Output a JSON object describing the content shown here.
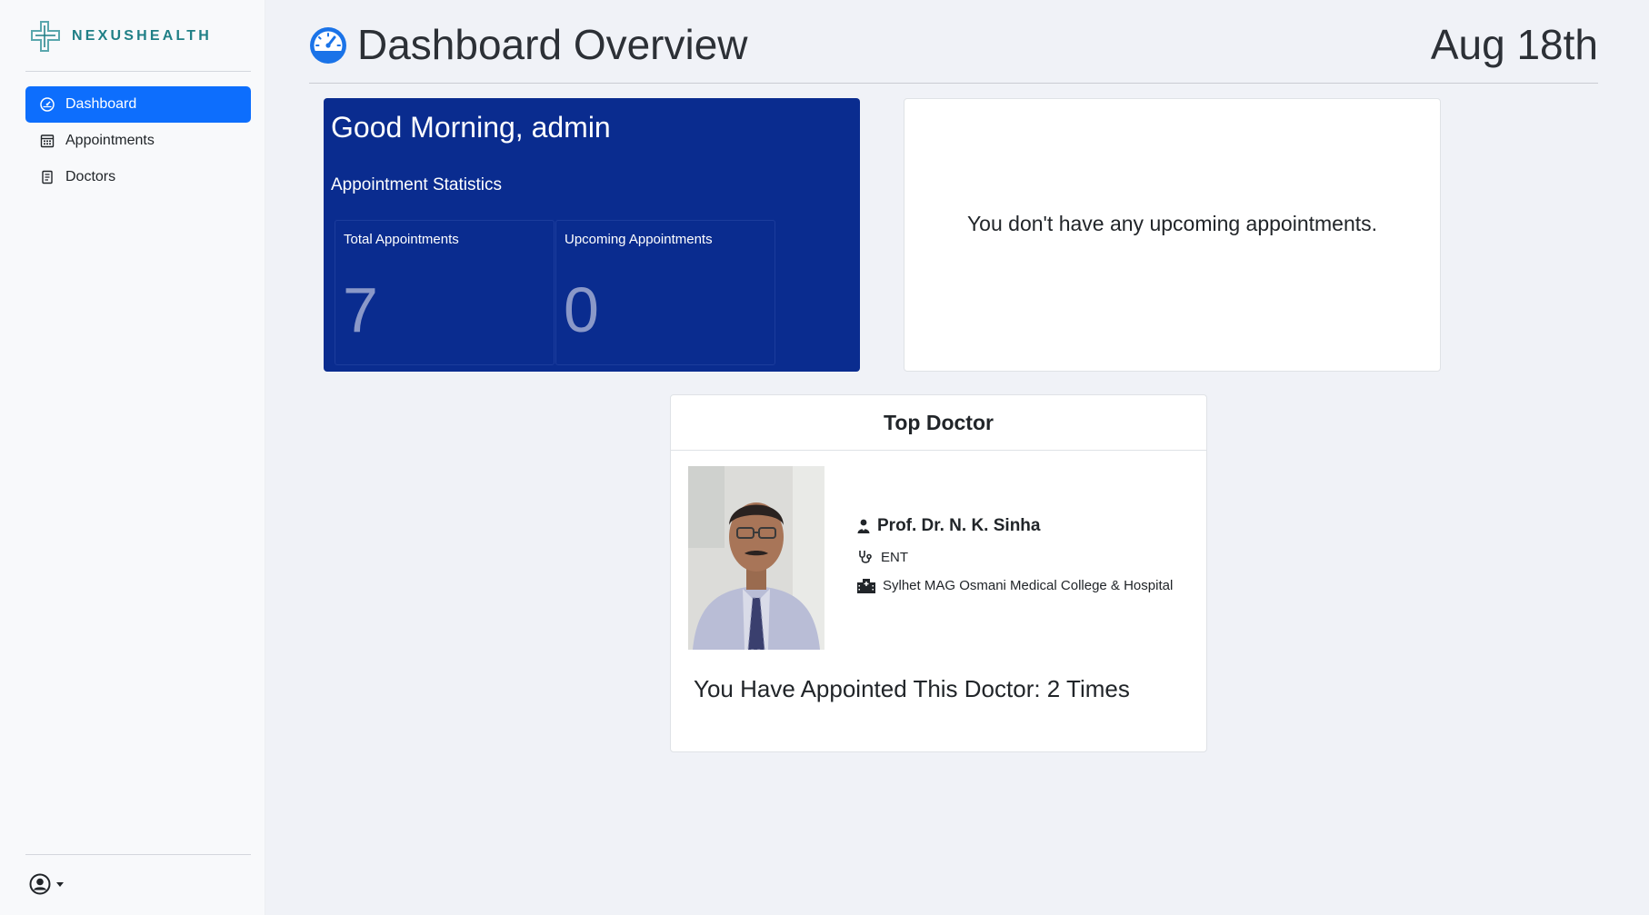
{
  "sidebar": {
    "brand": "NEXUSHEALTH",
    "items": [
      {
        "label": "Dashboard",
        "icon": "gauge-icon",
        "active": true
      },
      {
        "label": "Appointments",
        "icon": "calendar-icon",
        "active": false
      },
      {
        "label": "Doctors",
        "icon": "clipboard-icon",
        "active": false
      }
    ],
    "user_icon": "user-circle-icon"
  },
  "header": {
    "title": "Dashboard Overview",
    "date": "Aug 18th",
    "icon": "speedometer-icon"
  },
  "greeting": {
    "title": "Good Morning, admin",
    "stats_title": "Appointment Statistics",
    "stats": [
      {
        "label": "Total Appointments",
        "value": "7"
      },
      {
        "label": "Upcoming Appointments",
        "value": "0"
      }
    ]
  },
  "upcoming": {
    "message": "You don't have any upcoming appointments."
  },
  "top_doctor": {
    "heading": "Top Doctor",
    "name": "Prof. Dr. N. K. Sinha",
    "specialty": "ENT",
    "hospital": "Sylhet MAG Osmani Medical College & Hospital",
    "appointed_text": "You Have Appointed This Doctor: 2 Times"
  },
  "colors": {
    "primary": "#0d6efd",
    "greeting_bg": "#0a2c8f",
    "brand": "#1f7f86"
  }
}
